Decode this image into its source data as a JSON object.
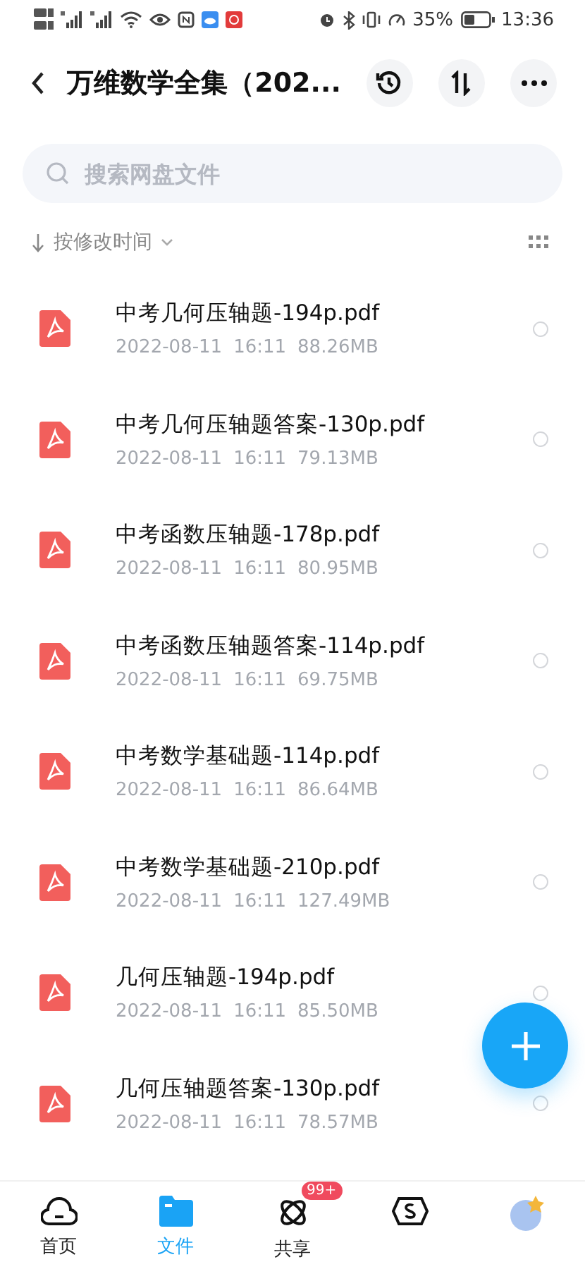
{
  "status_bar": {
    "battery": "35%",
    "time": "13:36"
  },
  "header": {
    "title": "万维数学全集（202..."
  },
  "search": {
    "placeholder": "搜索网盘文件"
  },
  "sort": {
    "label": "按修改时间"
  },
  "files": [
    {
      "name": "中考几何压轴题-194p.pdf",
      "date": "2022-08-11",
      "time": "16:11",
      "size": "88.26MB",
      "selected": false
    },
    {
      "name": "中考几何压轴题答案-130p.pdf",
      "date": "2022-08-11",
      "time": "16:11",
      "size": "79.13MB",
      "selected": false
    },
    {
      "name": "中考函数压轴题-178p.pdf",
      "date": "2022-08-11",
      "time": "16:11",
      "size": "80.95MB",
      "selected": false
    },
    {
      "name": "中考函数压轴题答案-114p.pdf",
      "date": "2022-08-11",
      "time": "16:11",
      "size": "69.75MB",
      "selected": false
    },
    {
      "name": "中考数学基础题-114p.pdf",
      "date": "2022-08-11",
      "time": "16:11",
      "size": "86.64MB",
      "selected": false
    },
    {
      "name": "中考数学基础题-210p.pdf",
      "date": "2022-08-11",
      "time": "16:11",
      "size": "127.49MB",
      "selected": false
    },
    {
      "name": "几何压轴题-194p.pdf",
      "date": "2022-08-11",
      "time": "16:11",
      "size": "85.50MB",
      "selected": false
    },
    {
      "name": "几何压轴题答案-130p.pdf",
      "date": "2022-08-11",
      "time": "16:11",
      "size": "78.57MB",
      "selected": false
    }
  ],
  "nav": [
    {
      "kind": "home",
      "label": "首页",
      "selected": false
    },
    {
      "kind": "files",
      "label": "文件",
      "selected": true
    },
    {
      "kind": "share",
      "label": "共享",
      "selected": false,
      "badge": "99+"
    },
    {
      "kind": "coin",
      "selected": false
    },
    {
      "kind": "avatar",
      "selected": false
    }
  ]
}
